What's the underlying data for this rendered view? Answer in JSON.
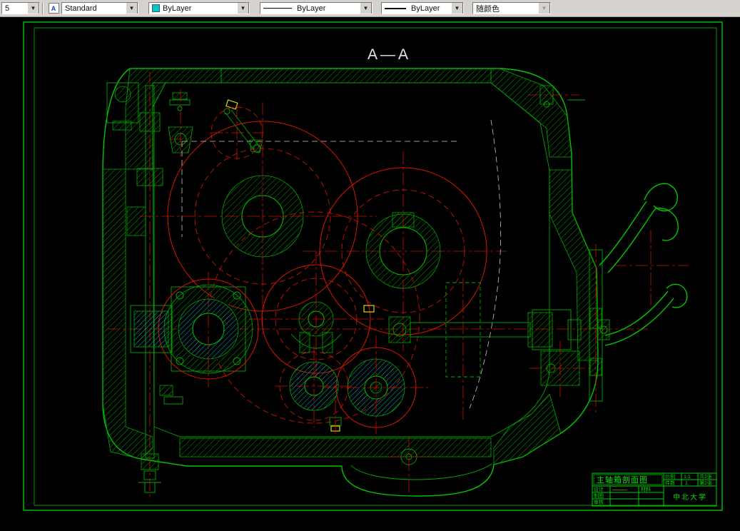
{
  "toolbar": {
    "partial_combo_value": "5",
    "text_style_combo": "Standard",
    "color_combo": "ByLayer",
    "linetype_combo": "ByLayer",
    "lineweight_combo": "ByLayer",
    "plot_style_combo": "随颜色",
    "style_icon": "text-style-icon",
    "color_swatch_hex": "#00c8c8"
  },
  "drawing": {
    "section_title": "A—A",
    "colors": {
      "entity_green": "#00c800",
      "centerline_red": "#d01000",
      "hatch_cyan": "#00b8b8",
      "hidden_white": "#c8c8c8",
      "highlight_yellow": "#d8d800",
      "background": "#000000"
    }
  },
  "title_block": {
    "drawing_title": "主轴箱剖面图",
    "scale_label": "比例",
    "scale_value": "1:1",
    "count_label": "件数",
    "count_value": "1",
    "sheet_total": "共2张",
    "sheet_no": "第2张",
    "design_label": "设计",
    "design_value": "———",
    "draft_label": "制图",
    "check_label": "审核",
    "material_label": "材料",
    "org_name": "中北大学"
  }
}
